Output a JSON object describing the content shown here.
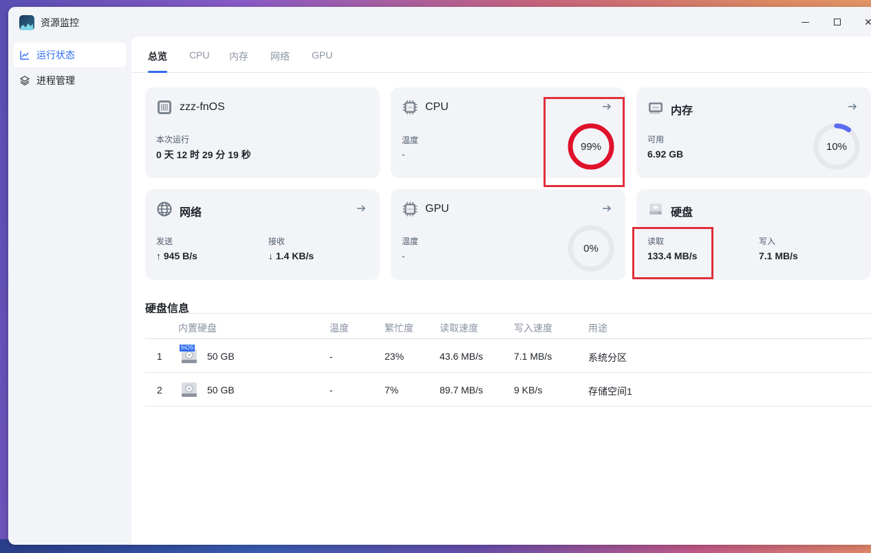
{
  "app": {
    "title": "资源监控",
    "icon": "resource-monitor-app-icon"
  },
  "window_controls": {
    "minimize": "minimize-icon",
    "maximize": "maximize-icon",
    "close": "✕"
  },
  "sidebar": {
    "items": [
      {
        "label": "运行状态",
        "icon": "line-chart-icon",
        "active": true
      },
      {
        "label": "进程管理",
        "icon": "layers-icon",
        "active": false
      }
    ]
  },
  "tabs": [
    {
      "label": "总览",
      "active": true
    },
    {
      "label": "CPU",
      "active": false
    },
    {
      "label": "内存",
      "active": false
    },
    {
      "label": "网络",
      "active": false
    },
    {
      "label": "GPU",
      "active": false
    }
  ],
  "cards": {
    "system": {
      "title": "zzz-fnOS",
      "uptime_label": "本次运行",
      "uptime_value": "0 天 12 时 29 分 19 秒"
    },
    "cpu": {
      "title": "CPU",
      "temp_label": "温度",
      "temp_value": "-",
      "usage_text": "99%",
      "usage": 0.99
    },
    "memory": {
      "title": "内存",
      "avail_label": "可用",
      "avail_value": "6.92 GB",
      "usage_text": "10%",
      "usage": 0.1
    },
    "network": {
      "title": "网络",
      "send_label": "发送",
      "send_value": "↑ 945 B/s",
      "recv_label": "接收",
      "recv_value": "↓ 1.4 KB/s"
    },
    "gpu": {
      "title": "GPU",
      "temp_label": "温度",
      "temp_value": "-",
      "usage_text": "0%",
      "usage": 0.0
    },
    "disk": {
      "title": "硬盘",
      "read_label": "读取",
      "read_value": "133.4 MB/s",
      "write_label": "写入",
      "write_value": "7.1 MB/s"
    }
  },
  "disk_info": {
    "title": "硬盘信息",
    "columns": [
      "内置硬盘",
      "温度",
      "繁忙度",
      "读取速度",
      "写入速度",
      "用途"
    ],
    "rows": [
      {
        "index": "1",
        "badge": "fnOS",
        "size": "50 GB",
        "temp": "-",
        "busy": "23%",
        "read": "43.6 MB/s",
        "write": "7.1 MB/s",
        "usage": "系统分区"
      },
      {
        "index": "2",
        "badge": "",
        "size": "50 GB",
        "temp": "-",
        "busy": "7%",
        "read": "89.7 MB/s",
        "write": "9 KB/s",
        "usage": "存储空间1"
      }
    ]
  },
  "colors": {
    "accent": "#2f6bf0",
    "cpu_ring": "#e0112b",
    "mem_ring": "#5b6cf0",
    "ring_track": "#e6e8ec",
    "highlight": "#e02f3a"
  }
}
